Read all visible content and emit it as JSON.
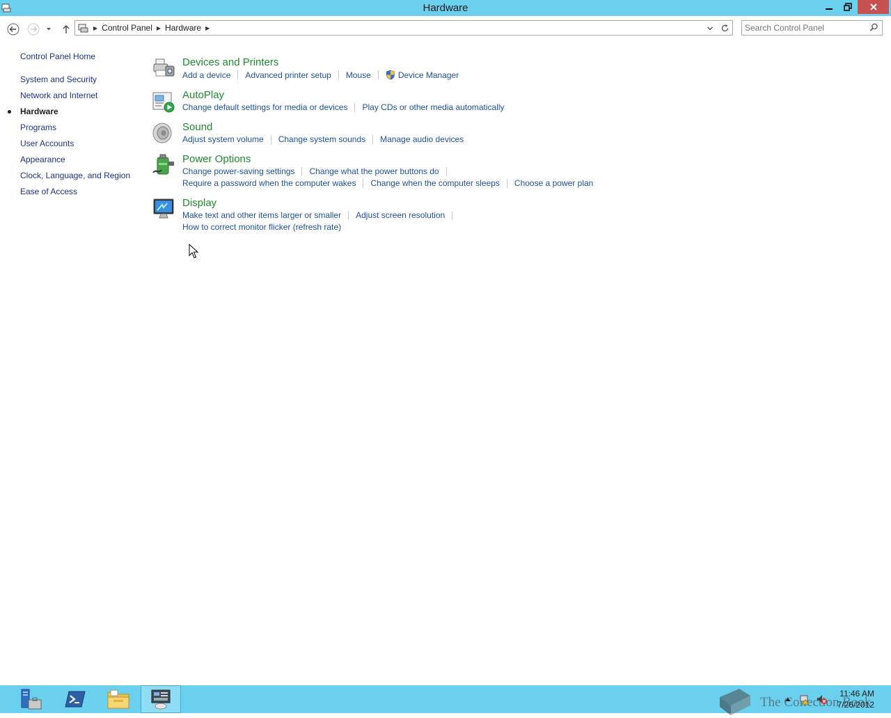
{
  "window": {
    "title": "Hardware"
  },
  "address": {
    "crumbs": [
      "Control Panel",
      "Hardware"
    ]
  },
  "search": {
    "placeholder": "Search Control Panel"
  },
  "leftnav": {
    "items": [
      {
        "label": "Control Panel Home",
        "current": false
      },
      {
        "label": "System and Security",
        "current": false
      },
      {
        "label": "Network and Internet",
        "current": false
      },
      {
        "label": "Hardware",
        "current": true
      },
      {
        "label": "Programs",
        "current": false
      },
      {
        "label": "User Accounts",
        "current": false
      },
      {
        "label": "Appearance",
        "current": false
      },
      {
        "label": "Clock, Language, and Region",
        "current": false
      },
      {
        "label": "Ease of Access",
        "current": false
      }
    ]
  },
  "categories": {
    "devices": {
      "title": "Devices and Printers",
      "links": [
        "Add a device",
        "Advanced printer setup",
        "Mouse",
        "Device Manager"
      ]
    },
    "autoplay": {
      "title": "AutoPlay",
      "links": [
        "Change default settings for media or devices",
        "Play CDs or other media automatically"
      ]
    },
    "sound": {
      "title": "Sound",
      "links": [
        "Adjust system volume",
        "Change system sounds",
        "Manage audio devices"
      ]
    },
    "power": {
      "title": "Power Options",
      "links": [
        "Change power-saving settings",
        "Change what the power buttons do",
        "Require a password when the computer wakes",
        "Change when the computer sleeps",
        "Choose a power plan"
      ]
    },
    "display": {
      "title": "Display",
      "links": [
        "Make text and other items larger or smaller",
        "Adjust screen resolution",
        "How to correct monitor flicker (refresh rate)"
      ]
    }
  },
  "taskbar": {
    "watermark": "The Collection Book",
    "time": "11:46 AM",
    "date": "7/26/2012"
  },
  "colors": {
    "titlebar": "#6bcfee",
    "category_title": "#1e8a2e",
    "link": "#1e50a0",
    "nav_link": "#1e3287"
  }
}
